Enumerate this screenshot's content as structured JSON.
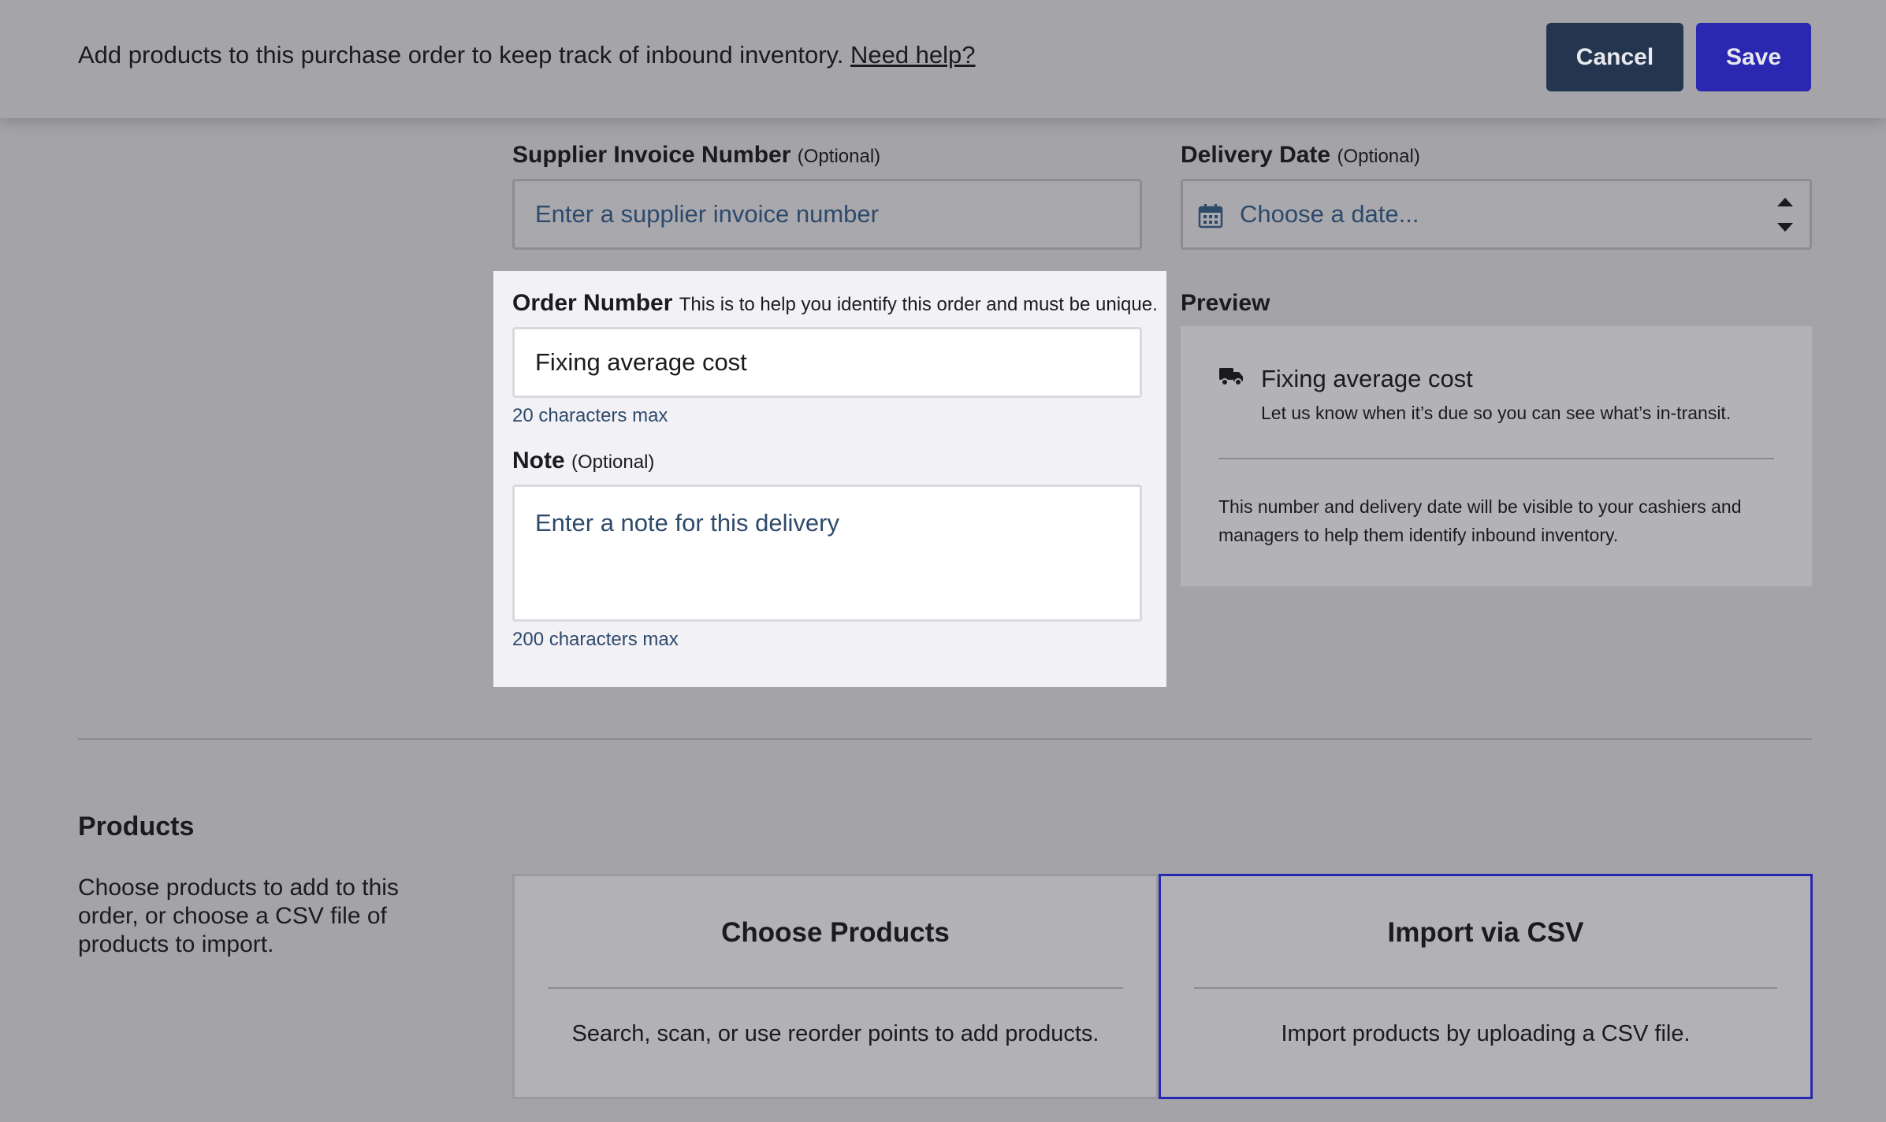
{
  "topbar": {
    "intro_text": "Add products to this purchase order to keep track of inbound inventory.",
    "help_link": "Need help?",
    "cancel_label": "Cancel",
    "save_label": "Save"
  },
  "supplier_invoice": {
    "label": "Supplier Invoice Number",
    "optional": "(Optional)",
    "placeholder": "Enter a supplier invoice number",
    "value": ""
  },
  "delivery_date": {
    "label": "Delivery Date",
    "optional": "(Optional)",
    "placeholder": "Choose a date...",
    "icon": "calendar-icon"
  },
  "order_number": {
    "label": "Order Number",
    "hint": "This is to help you identify this order and must be unique.",
    "value": "Fixing average cost",
    "max_note": "20 characters max"
  },
  "note": {
    "label": "Note",
    "optional": "(Optional)",
    "placeholder": "Enter a note for this delivery",
    "max_note": "200 characters max"
  },
  "preview": {
    "label": "Preview",
    "title": "Fixing average cost",
    "subtitle": "Let us know when it’s due so you can see what’s in-transit.",
    "description": "This number and delivery date will be visible to your cashiers and managers to help them identify inbound inventory.",
    "icon": "truck-icon"
  },
  "products": {
    "title": "Products",
    "description": "Choose products to add to this order, or choose a CSV file of products to import.",
    "options": [
      {
        "title": "Choose Products",
        "description": "Search, scan, or use reorder points to add products."
      },
      {
        "title": "Import via CSV",
        "description": "Import products by uploading a CSV file.",
        "selected": true
      }
    ]
  },
  "colors": {
    "accent": "#2a28b0",
    "cancel": "#24364f",
    "overlay_background": "#a3a3a8"
  }
}
